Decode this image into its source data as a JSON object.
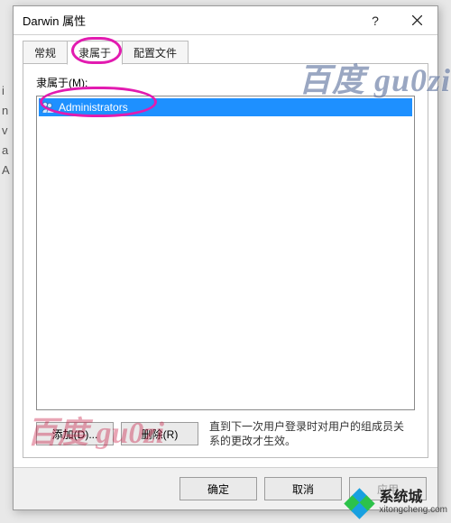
{
  "titlebar": {
    "title": "Darwin 属性",
    "help_label": "?",
    "close_label": "×"
  },
  "tabs": {
    "general": "常规",
    "memberof": "隶属于",
    "profile": "配置文件"
  },
  "panel": {
    "label": "隶属于(M):",
    "items": [
      {
        "text": "Administrators",
        "selected": true
      }
    ],
    "add_label": "添加(D)...",
    "remove_label": "删除(R)",
    "hint_line1": "直到下一次用户登录时对用户的组成员关",
    "hint_line2": "系的更改才生效。"
  },
  "dialog_buttons": {
    "ok": "确定",
    "cancel": "取消",
    "apply": "应用"
  },
  "watermarks": {
    "wm1": "百度 gu0zi",
    "wm2": "百度  gu0zi",
    "site_cn": "系统城",
    "site_en": "xitongcheng.com"
  },
  "bg_fragments": [
    "i",
    "n",
    "v",
    "a",
    "A"
  ]
}
